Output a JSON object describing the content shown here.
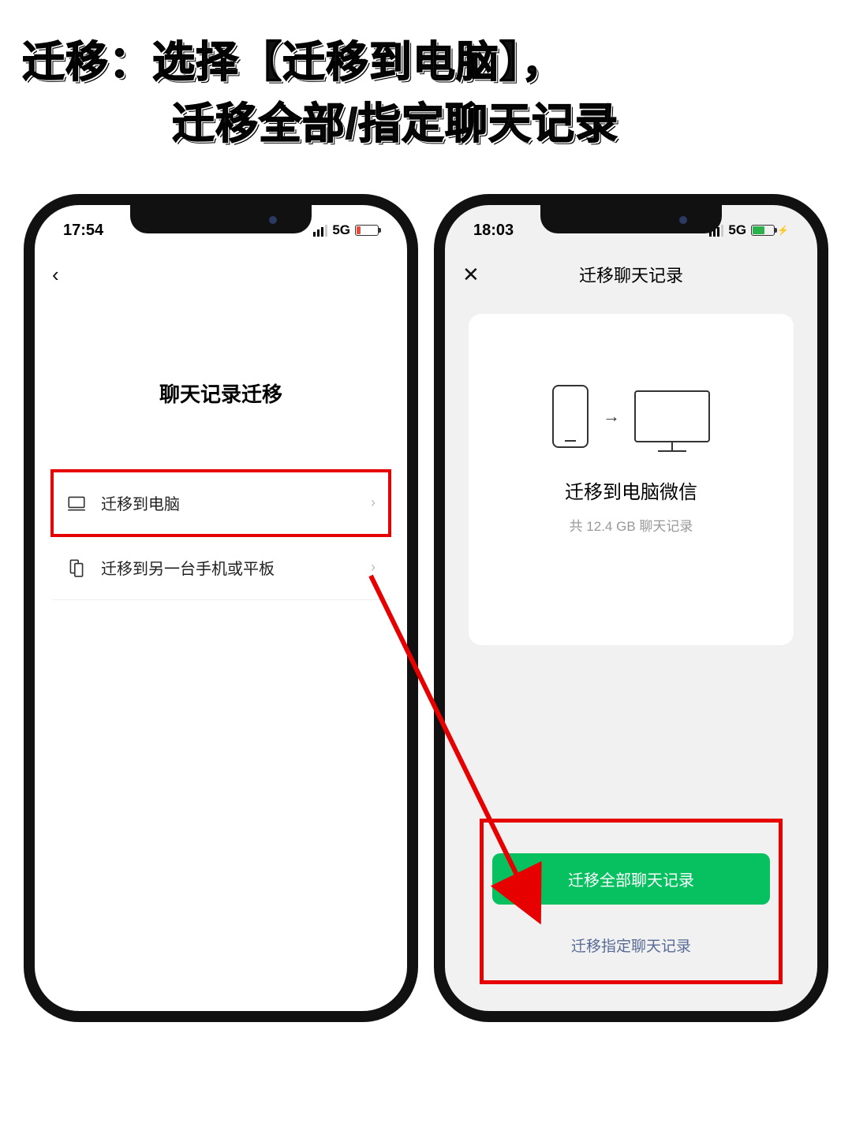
{
  "headline": {
    "line1": "迁移：选择【迁移到电脑】，",
    "line2": "迁移全部/指定聊天记录"
  },
  "left_phone": {
    "status": {
      "time": "17:54",
      "network": "5G"
    },
    "nav_back": "‹",
    "page_title": "聊天记录迁移",
    "options": [
      {
        "icon": "computer-icon",
        "label": "迁移到电脑",
        "highlight": true
      },
      {
        "icon": "device-icon",
        "label": "迁移到另一台手机或平板",
        "highlight": false
      }
    ]
  },
  "right_phone": {
    "status": {
      "time": "18:03",
      "network": "5G"
    },
    "nav_close": "✕",
    "nav_title": "迁移聊天记录",
    "card": {
      "title": "迁移到电脑微信",
      "subtitle": "共 12.4 GB 聊天记录"
    },
    "actions": {
      "primary": "迁移全部聊天记录",
      "secondary": "迁移指定聊天记录"
    }
  }
}
